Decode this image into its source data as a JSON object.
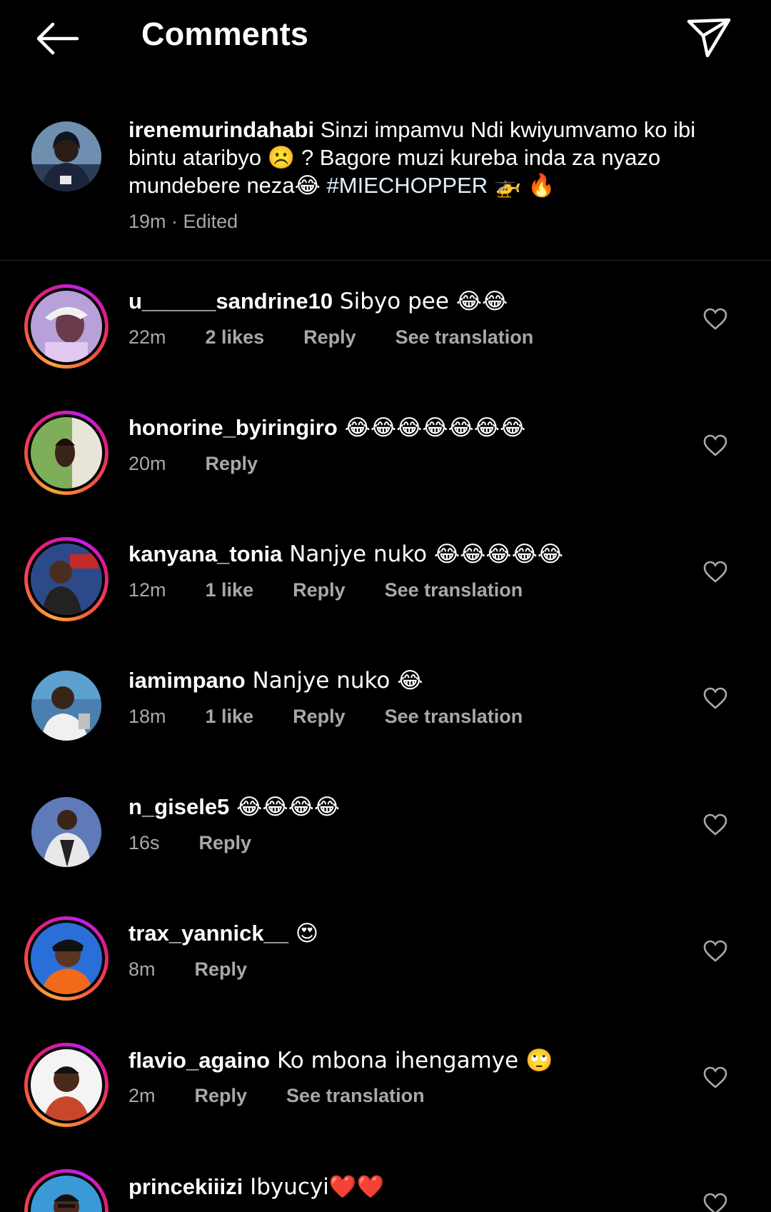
{
  "header": {
    "title": "Comments",
    "back_icon": "back-arrow-icon",
    "share_icon": "send-icon"
  },
  "caption": {
    "username": "irenemurindahabi",
    "text_part1": " Sinzi impamvu Ndi kwiyumvamo ko ibi bintu ataribyo ☹️ ?  Bagore muzi kureba inda za nyazo mundebere neza😂 ",
    "hashtag": "#MIECHOPPER",
    "text_part2": " 🚁 🔥",
    "time": "19m",
    "edited": "· Edited"
  },
  "comments": [
    {
      "username": "u______sandrine10",
      "text": " Sibyo pee 😂😂",
      "time": "22m",
      "likes": "2 likes",
      "reply": "Reply",
      "translation": "See translation",
      "story_ring": true
    },
    {
      "username": "honorine_byiringiro",
      "text": " 😂😂😂😂😂😂😂",
      "time": "20m",
      "likes": "",
      "reply": "Reply",
      "translation": "",
      "story_ring": true
    },
    {
      "username": "kanyana_tonia",
      "text": " Nanjye nuko 😂😂😂😂😂",
      "time": "12m",
      "likes": "1 like",
      "reply": "Reply",
      "translation": "See translation",
      "story_ring": true
    },
    {
      "username": "iamimpano",
      "text": " Nanjye nuko 😂",
      "time": "18m",
      "likes": "1 like",
      "reply": "Reply",
      "translation": "See translation",
      "story_ring": false
    },
    {
      "username": "n_gisele5",
      "text": " 😂😂😂😂",
      "time": "16s",
      "likes": "",
      "reply": "Reply",
      "translation": "",
      "story_ring": false
    },
    {
      "username": "trax_yannick__",
      "text": " 😍",
      "time": "8m",
      "likes": "",
      "reply": "Reply",
      "translation": "",
      "story_ring": true
    },
    {
      "username": "flavio_againo",
      "text": " Ko mbona ihengamye 🙄",
      "time": "2m",
      "likes": "",
      "reply": "Reply",
      "translation": "See translation",
      "story_ring": true
    },
    {
      "username": "princekiiizi",
      "text": " Ibyucyi❤️❤️",
      "time": "",
      "likes": "",
      "reply": "",
      "translation": "",
      "story_ring": true
    }
  ],
  "colors": {
    "background": "#000000",
    "text": "#ffffff",
    "secondary": "#a8a8a8",
    "hashtag": "#e0f1ff"
  }
}
